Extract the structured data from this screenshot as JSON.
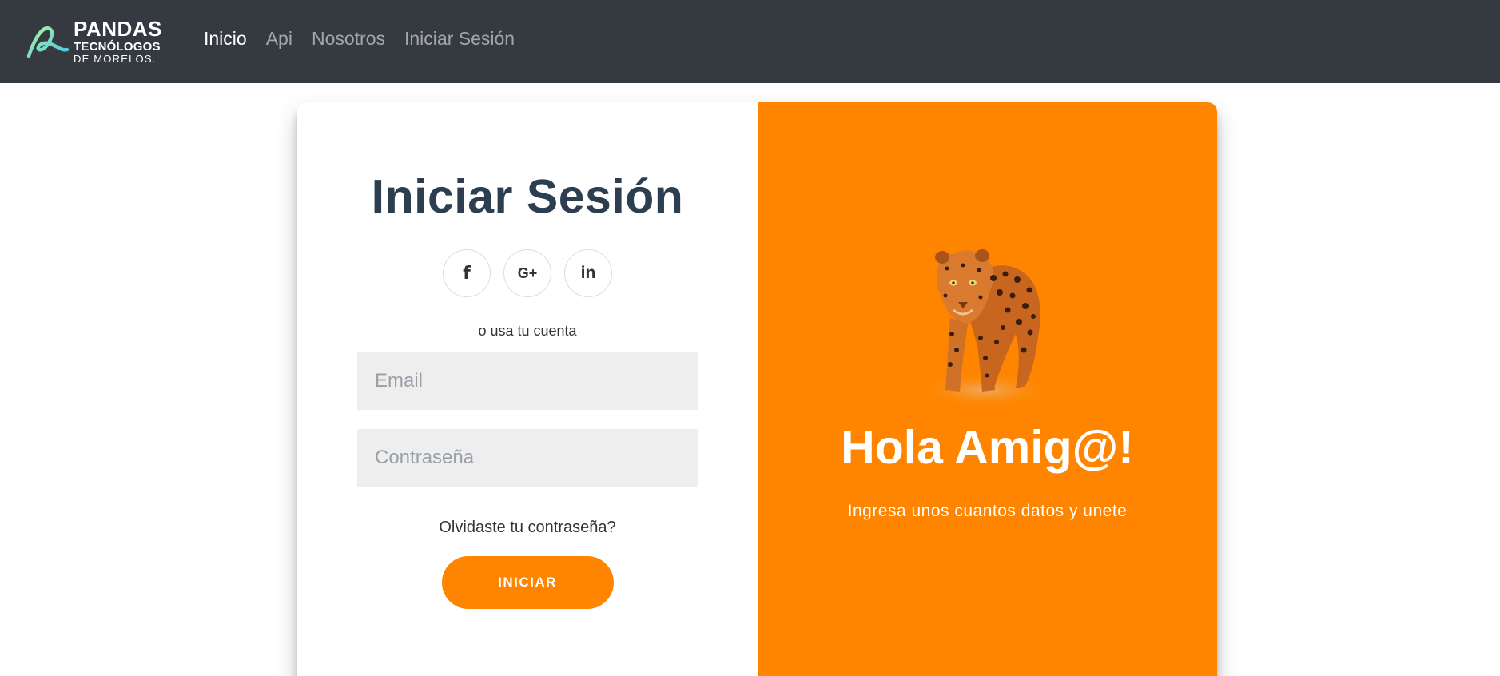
{
  "brand": {
    "line1": "PANDAS",
    "line2": "TECNÓLOGOS",
    "line3": "DE MORELOS."
  },
  "nav": {
    "items": [
      {
        "label": "Inicio",
        "active": true
      },
      {
        "label": "Api",
        "active": false
      },
      {
        "label": "Nosotros",
        "active": false
      },
      {
        "label": "Iniciar Sesión",
        "active": false
      }
    ]
  },
  "login": {
    "title": "Iniciar Sesión",
    "socials": [
      {
        "icon": "facebook-icon",
        "glyph": "f"
      },
      {
        "icon": "google-plus-icon",
        "glyph": "G+"
      },
      {
        "icon": "linkedin-icon",
        "glyph": "in"
      }
    ],
    "alt_text": "o usa tu cuenta",
    "email_placeholder": "Email",
    "email_value": "",
    "password_placeholder": "Contraseña",
    "password_value": "",
    "forgot": "Olvidaste tu contraseña?",
    "submit": "INICIAR"
  },
  "overlay": {
    "title": "Hola Amig@!",
    "text": "Ingresa unos cuantos datos y unete",
    "image": "jaguar-image"
  },
  "colors": {
    "navbar": "#343a40",
    "accent": "#ff8500",
    "title": "#2c3e50",
    "input_bg": "#eeeeee"
  }
}
